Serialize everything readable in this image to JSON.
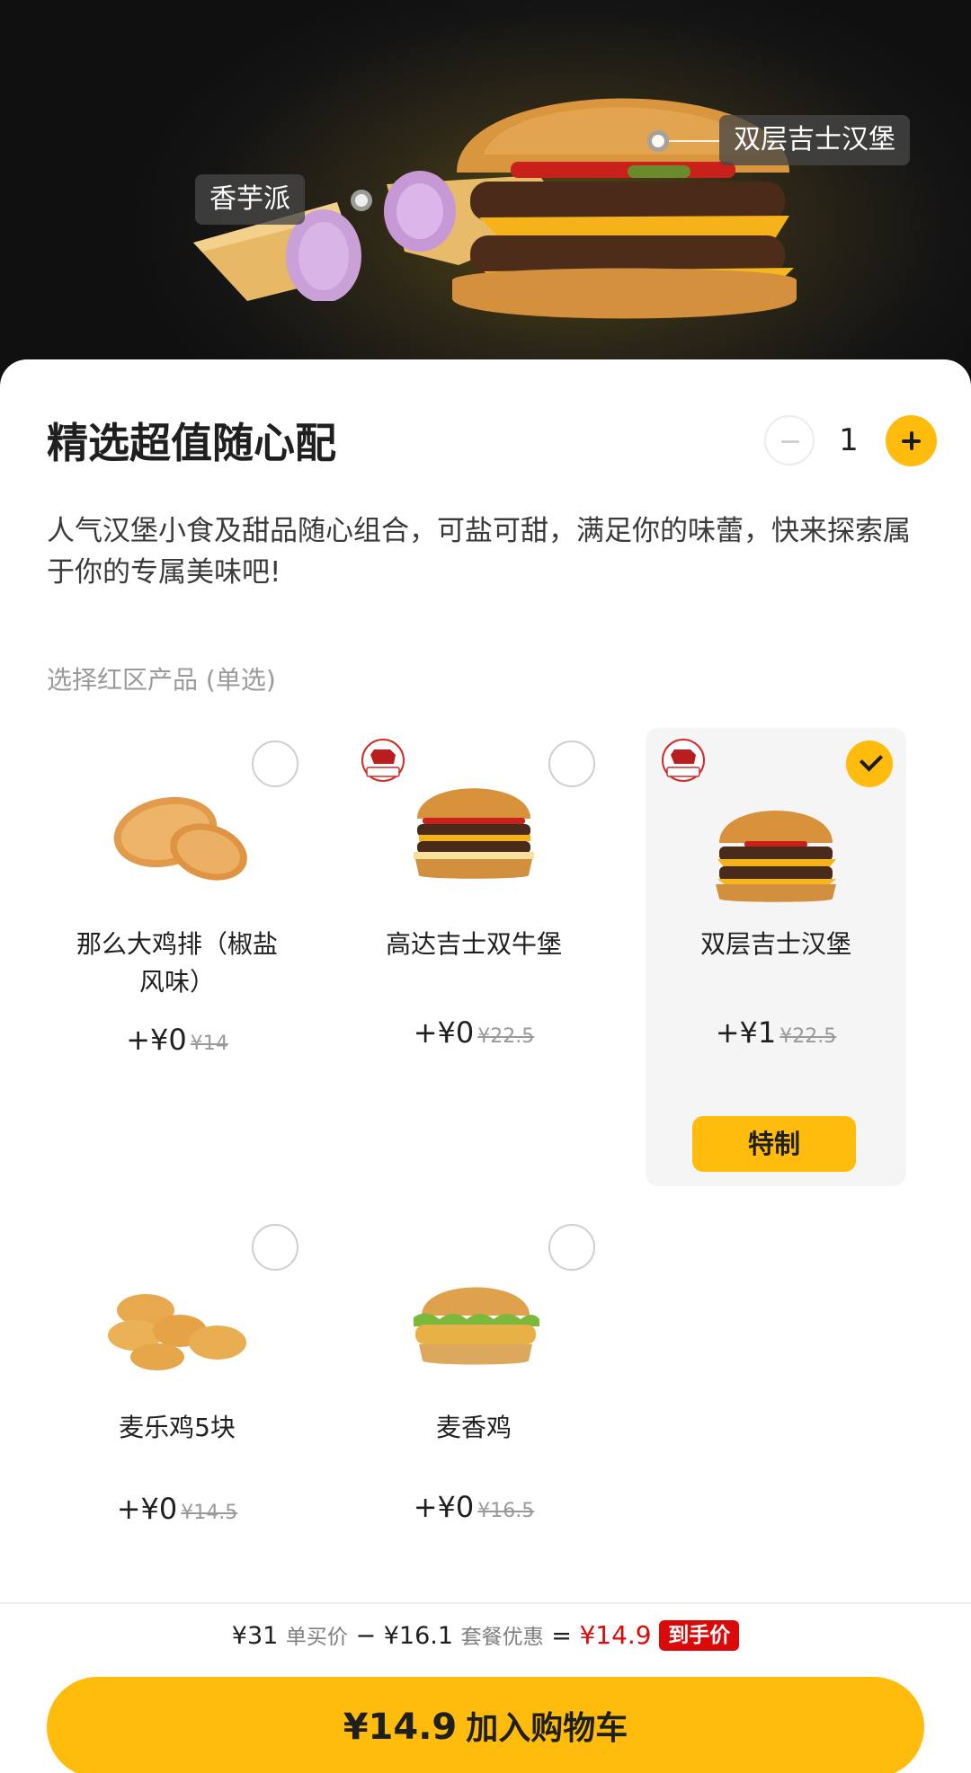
{
  "hero": {
    "tags": [
      "香芋派",
      "双层吉士汉堡"
    ]
  },
  "product": {
    "title": "精选超值随心配",
    "quantity": "1",
    "description": "人气汉堡小食及甜品随心组合，可盐可甜，满足你的味蕾，快来探索属于你的专属美味吧!"
  },
  "section": {
    "label": "选择红区产品 (单选)"
  },
  "options": [
    {
      "name": "那么大鸡排（椒盐风味）",
      "price": "+¥0",
      "original_price": "¥14",
      "selected": false,
      "badge": ""
    },
    {
      "name": "高达吉士双牛堡",
      "price": "+¥0",
      "original_price": "¥22.5",
      "selected": false,
      "badge": "100%纯牛肉"
    },
    {
      "name": "双层吉士汉堡",
      "price": "+¥1",
      "original_price": "¥22.5",
      "selected": true,
      "badge": "100%纯牛肉",
      "custom_label": "特制"
    },
    {
      "name": "麦乐鸡5块",
      "price": "+¥0",
      "original_price": "¥14.5",
      "selected": false,
      "badge": ""
    },
    {
      "name": "麦香鸡",
      "price": "+¥0",
      "original_price": "¥16.5",
      "selected": false,
      "badge": ""
    }
  ],
  "summary": {
    "single_price": "¥31",
    "single_label": "单买价",
    "minus": "−",
    "discount": "¥16.1",
    "discount_label": "套餐优惠",
    "equals": "=",
    "final_price": "¥14.9",
    "final_label": "到手价"
  },
  "cart": {
    "price": "¥14.9",
    "label": "加入购物车"
  },
  "colors": {
    "accent": "#ffbc0d",
    "price_red": "#da0a0a",
    "selected_card_bg": "#f5f5f5"
  }
}
